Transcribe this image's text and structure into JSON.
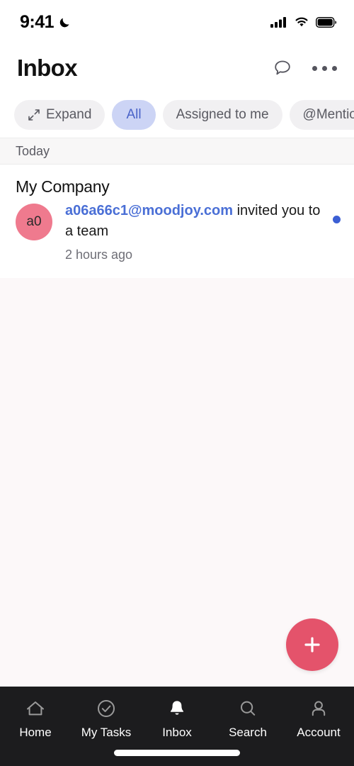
{
  "status_bar": {
    "time": "9:41",
    "dnd_icon": "crescent-moon-icon",
    "signal_icon": "cellular-signal-icon",
    "wifi_icon": "wifi-icon",
    "battery_icon": "battery-full-icon"
  },
  "header": {
    "title": "Inbox",
    "chat_icon": "speech-bubble-icon",
    "overflow_icon": "more-horizontal-icon"
  },
  "filters": [
    {
      "label": "Expand",
      "icon": "expand-arrows-icon",
      "selected": false
    },
    {
      "label": "All",
      "icon": "",
      "selected": true
    },
    {
      "label": "Assigned to me",
      "icon": "",
      "selected": false
    },
    {
      "label": "@Mentioned",
      "icon": "",
      "selected": false
    }
  ],
  "section": {
    "label": "Today"
  },
  "notification": {
    "title": "My Company",
    "avatar_initials": "a0",
    "link_text": "a06a66c1@moodjoy.com",
    "message_text": " invited you to a team",
    "timestamp": "2 hours ago",
    "unread": true
  },
  "fab": {
    "icon": "plus-icon",
    "label": "+"
  },
  "bottom_nav": [
    {
      "label": "Home",
      "icon": "home-icon",
      "active": false
    },
    {
      "label": "My Tasks",
      "icon": "check-circle-icon",
      "active": false
    },
    {
      "label": "Inbox",
      "icon": "bell-filled-icon",
      "active": true
    },
    {
      "label": "Search",
      "icon": "search-icon",
      "active": false
    },
    {
      "label": "Account",
      "icon": "person-icon",
      "active": false
    }
  ],
  "colors": {
    "accent_pink": "#e4536b",
    "avatar_pink": "#ef7a8e",
    "link_blue": "#4a6fd6",
    "chip_selected_bg": "#ccd4f5",
    "chip_selected_text": "#4a63c8",
    "unread_dot": "#3b5fd4",
    "nav_bg": "#1c1c1e",
    "page_bg": "#fcf8f9"
  }
}
